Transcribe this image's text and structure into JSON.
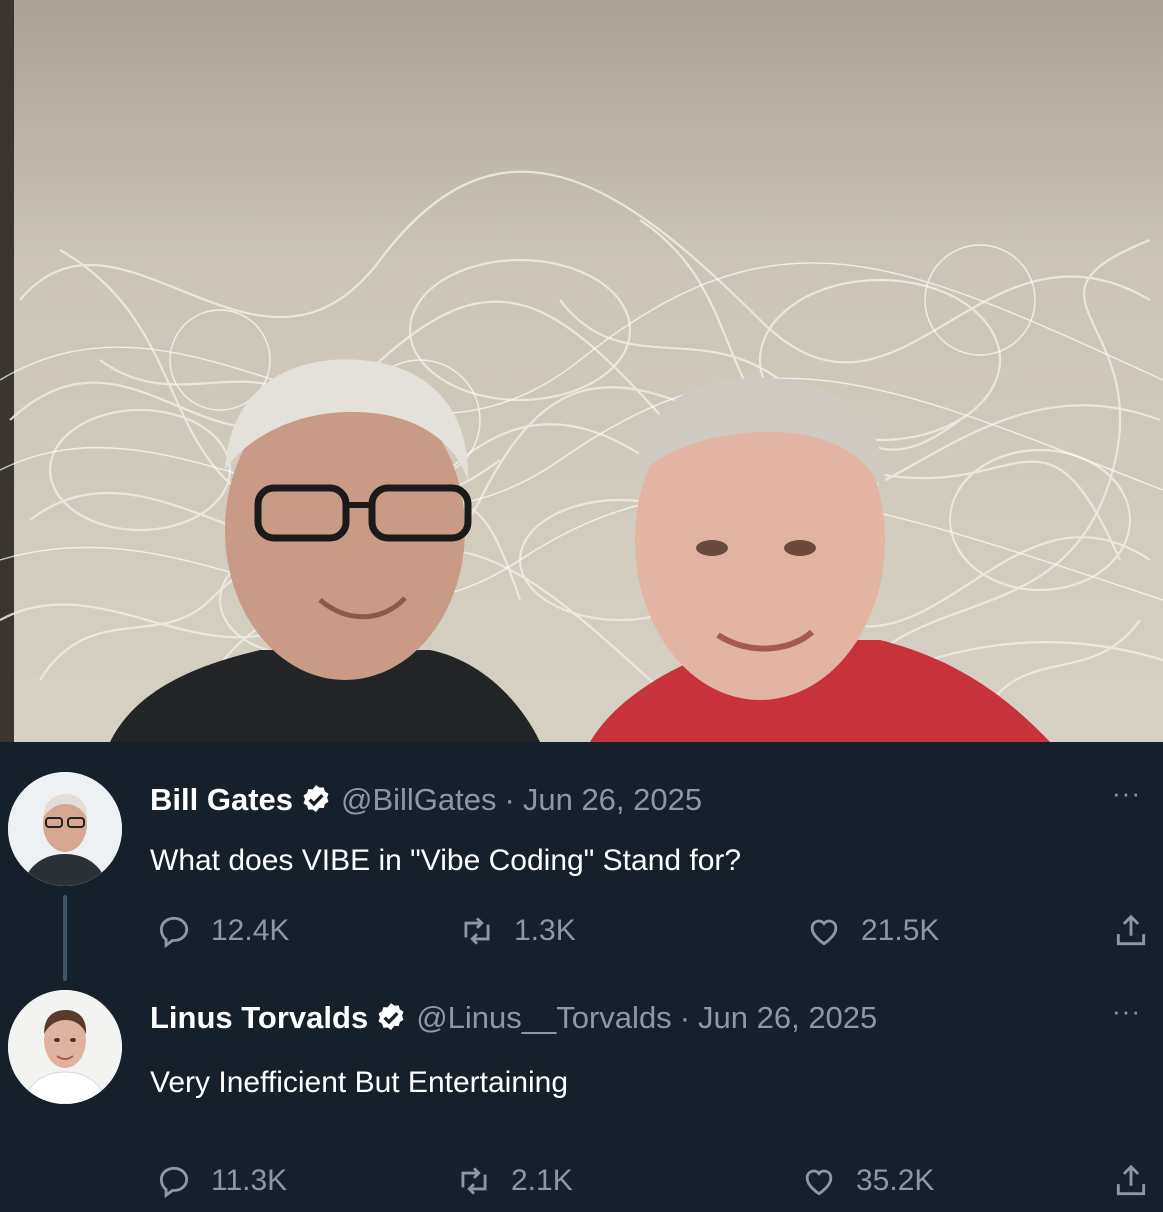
{
  "photo": {
    "description_icon": "photo-of-two-men-icon",
    "background_color": "#cfc8bb"
  },
  "tweets": [
    {
      "name": "Bill Gates",
      "handle": "@BillGates",
      "separator": "·",
      "date": "Jun 26, 2025",
      "text": "What does VIBE in \"Vibe Coding\" Stand for?",
      "more": "···",
      "replies": "12.4K",
      "retweets": "1.3K",
      "likes": "21.5K"
    },
    {
      "name": "Linus Torvalds",
      "handle": "@Linus__Torvalds",
      "separator": "·",
      "date": "Jun 26, 2025",
      "text": "Very Inefficient But Entertaining",
      "more": "···",
      "replies": "11.3K",
      "retweets": "2.1K",
      "likes": "35.2K"
    }
  ],
  "colors": {
    "background": "#15202b",
    "secondary_text": "#8b98a5",
    "thread_line": "#3d5466"
  },
  "icons": {
    "verified": "verified-badge-icon",
    "reply": "reply-icon",
    "retweet": "retweet-icon",
    "like": "heart-icon",
    "share": "share-icon",
    "more": "more-options-icon"
  }
}
